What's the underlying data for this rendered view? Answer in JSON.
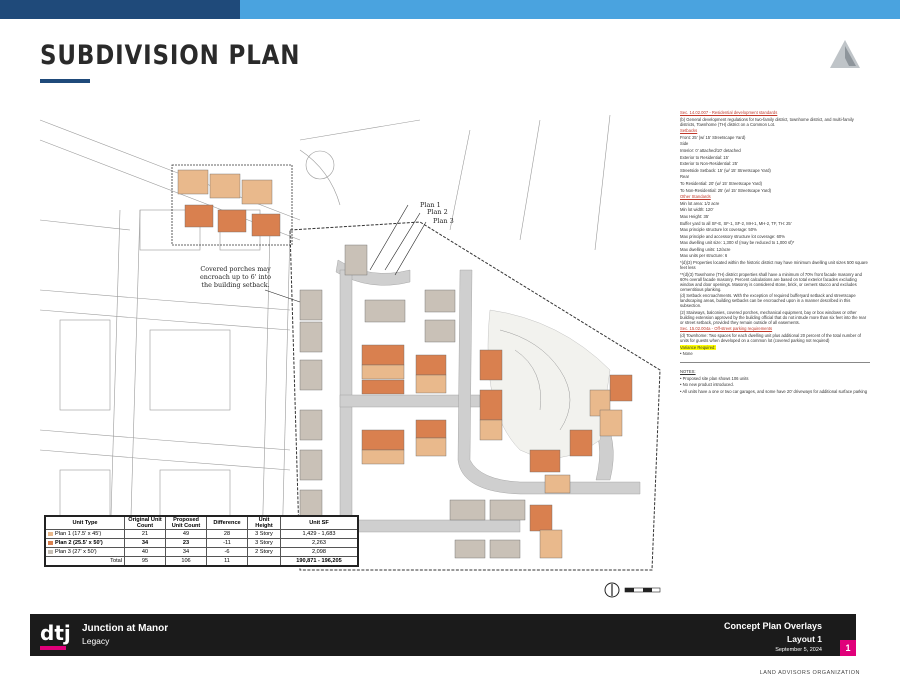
{
  "header": {
    "title": "SUBDIVISION PLAN"
  },
  "callouts": {
    "plan1": "Plan 1",
    "plan2": "Plan 2",
    "plan3": "Plan 3",
    "porches_l1": "Covered porches may",
    "porches_l2": "encroach up to 6' into",
    "porches_l3": "the building setback."
  },
  "notes": {
    "sec1_title": "Sec. 14.02.007 - Residential development standards",
    "sec1_b": "(b)     General development regulations for two-family district, townhome district, and multi-family districts, Townhome (TH) district on a Common Lot.",
    "setbacks_title": "Setbacks",
    "setbacks": [
      "Front: 25' (w/ 15' Streetscape Yard)",
      "Side",
      "Interior: 0' attached/10' detached",
      "Exterior to Residential: 15'",
      "Exterior to Non-Residential: 25'",
      "Streetside Setback: 15' (w/ 15' Streetscape Yard)",
      "Rear",
      "To Residential: 20' (w/ 15' Streetscape Yard)",
      "To Non-Residential: 25' (w/ 15' Streetscape Yard)"
    ],
    "other_title": "Other Standards",
    "other": [
      "Min lot area: 1/2 acre",
      "Min lot width: 120'",
      "Max Height: 35'",
      "Buffer yard to all SF-E, SF-1, SF-2, MH-1, MH-2, TF, TH: 25'",
      "Max principle structure lot coverage: 50%",
      "Max principle and accessory structure lot coverage: 60%",
      "Max dwelling unit size: 1,300 sf (may be reduced to 1,000 sf)*",
      "Max dwelling units: 12/acre",
      "Max units per structure: 6"
    ],
    "footnote1": "*(d)(3) Properties located within the historic district may have minimum dwelling unit sizes 500 square feet less",
    "footnote2": "**(d)(3) Townhome (TH) district properties shall have a minimum of 70% front facade masonry and 60% overall facade masonry. Percent calculations are based on total exterior facades excluding window and door openings. Masonry is considered stone, brick, or cement stucco and excludes cementitious planking.",
    "item_d": "(d)     Setback encroachments. With the exception of required bufferyard setback and streetscape landscaping areas, building setbacks can be encroached upon in a manner described in this subsection.",
    "item_2": "(2)     Stairways, balconies, covered porches, mechanical equipment, bay or box windows or other building extension approved by the building official that do not intrude more than six feet into the rear or street setback, provided they remain outside of all easements.",
    "sec2_title": "Sec. 15.02.004a - Off-street parking requirements",
    "sec2_d": "(d)     Townhome: Two spaces for each dwelling unit plus additional 20 percent of the total number of units for guests when developed on a common lot (covered parking not required)",
    "variance_label": "Variance Required:",
    "variance_value": "None",
    "notes_title": "NOTES:",
    "bullets": [
      "Proposed site plan shows 106 units",
      "No new product introduced.",
      "All units have a one or two car garages, and some have 20' driveways for additional surface parking"
    ]
  },
  "table": {
    "headers": [
      "Unit Type",
      "Original Unit Count",
      "Proposed Unit Count",
      "Difference",
      "Unit Height",
      "Unit SF"
    ],
    "rows": [
      {
        "type": "Plan 1 (17.5' x 45')",
        "orig": "21",
        "prop": "49",
        "diff": "28",
        "height": "3 Story",
        "sf": "1,429  -  1,683",
        "color": "#e9b98c"
      },
      {
        "type": "Plan 2 (25.5' x 50')",
        "orig": "34",
        "prop": "23",
        "diff": "-11",
        "height": "3 Story",
        "sf": "2,263",
        "color": "#d9804f"
      },
      {
        "type": "Plan 3 (27' x 50')",
        "orig": "40",
        "prop": "34",
        "diff": "-6",
        "height": "2 Story",
        "sf": "2,098",
        "color": "#c9c1b7"
      }
    ],
    "total": {
      "label": "Total",
      "orig": "95",
      "prop": "106",
      "diff": "11",
      "sf": "190,871  -  196,205"
    }
  },
  "footer": {
    "logo": "dtj",
    "project": "Junction at Manor",
    "subtitle": "Legacy",
    "right1": "Concept Plan Overlays",
    "right2": "Layout 1",
    "date": "September 5, 2024",
    "page": "1",
    "org": "LAND ADVISORS ORGANIZATION"
  },
  "colors": {
    "accent_dark": "#1f4a7a",
    "accent_light": "#4aa3df",
    "brand_pink": "#e0007a"
  }
}
